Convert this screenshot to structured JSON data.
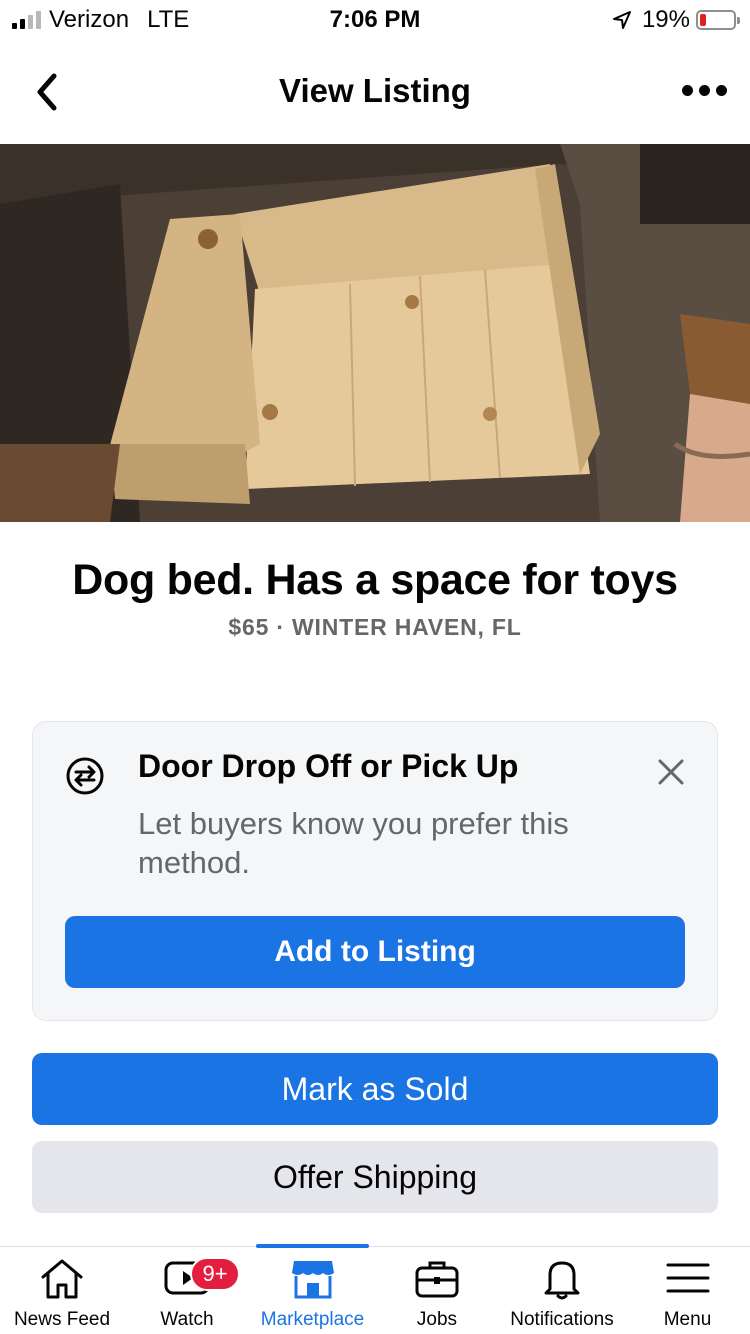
{
  "status_bar": {
    "carrier": "Verizon",
    "network": "LTE",
    "time": "7:06 PM",
    "battery_percent": "19%",
    "battery_level": 0.19,
    "signal_bars_filled": 2,
    "signal_bars_total": 4
  },
  "nav": {
    "title": "View Listing",
    "back_icon": "chevron-left-icon",
    "more_icon": "more-horizontal-icon"
  },
  "listing": {
    "title": "Dog bed. Has a space for toys",
    "meta": "$65 · WINTER HAVEN, FL"
  },
  "card": {
    "title": "Door Drop Off or Pick Up",
    "description": "Let buyers know you prefer this method.",
    "button_label": "Add to Listing",
    "icon": "swap-arrows-icon",
    "close_icon": "close-icon"
  },
  "actions": {
    "mark_sold": "Mark as Sold",
    "offer_shipping": "Offer Shipping"
  },
  "tabs": [
    {
      "label": "News Feed",
      "icon": "home-icon"
    },
    {
      "label": "Watch",
      "icon": "video-icon",
      "badge": "9+"
    },
    {
      "label": "Marketplace",
      "icon": "shop-icon",
      "active": true
    },
    {
      "label": "Jobs",
      "icon": "briefcase-icon"
    },
    {
      "label": "Notifications",
      "icon": "bell-icon"
    },
    {
      "label": "Menu",
      "icon": "hamburger-menu-icon"
    }
  ],
  "colors": {
    "accent": "#1b74e4",
    "secondary_button": "#e4e6eb",
    "badge": "#e41e3f",
    "muted_text": "#65676b",
    "battery_low": "#e02020"
  }
}
